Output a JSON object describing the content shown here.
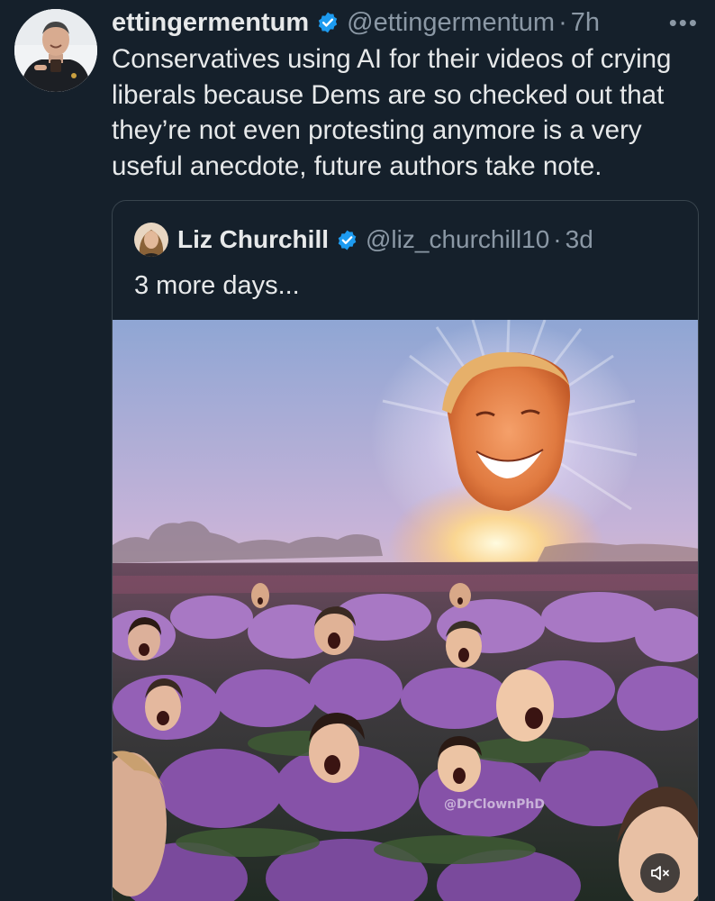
{
  "tweet": {
    "display_name": "ettingermentum",
    "handle": "@ettingermentum",
    "separator": "·",
    "time": "7h",
    "more_label": "•••",
    "text": "Conservatives using AI for their videos of crying liberals because Dems are so checked out that they’re not even protesting anymore is a very useful anecdote, future authors take note."
  },
  "quote": {
    "display_name": "Liz Churchill",
    "handle": "@liz_churchill10",
    "separator": "·",
    "time": "3d",
    "text": "3 more days...",
    "watermark": "@DrClownPhD"
  },
  "icons": {
    "verified": "verified-badge-icon",
    "more": "more-options-icon",
    "mute": "volume-muted-icon"
  },
  "colors": {
    "background": "#15202b",
    "text_primary": "#e7e9ea",
    "text_secondary": "#8b98a5",
    "verified_blue": "#1d9bf0",
    "border": "#38444d"
  }
}
